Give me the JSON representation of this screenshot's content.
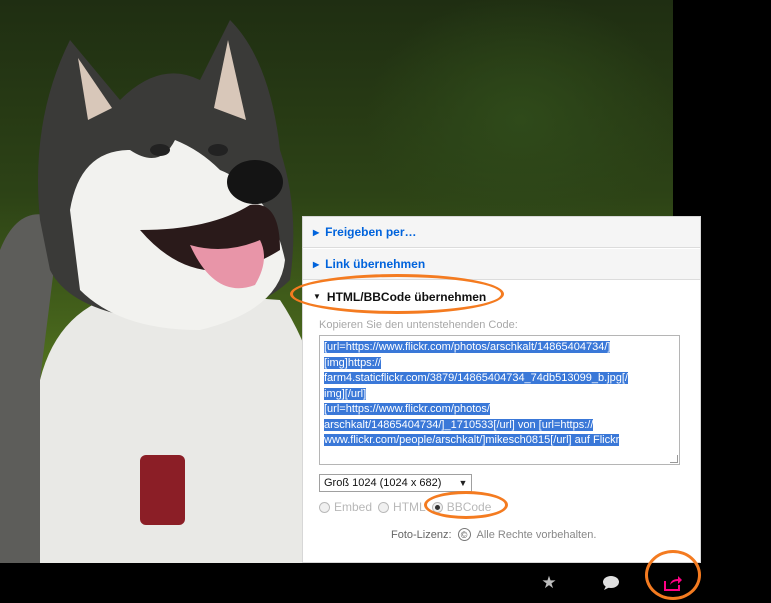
{
  "share_panel": {
    "sections": [
      {
        "label": "Freigeben per…",
        "expanded": false
      },
      {
        "label": "Link übernehmen",
        "expanded": false
      },
      {
        "label": "HTML/BBCode übernehmen",
        "expanded": true
      }
    ],
    "copy_hint": "Kopieren Sie den untenstehenden Code:",
    "code_lines": [
      "[url=https://www.flickr.com/photos/arschkalt/14865404734/]",
      "[img]https://",
      "farm4.staticflickr.com/3879/14865404734_74db513099_b.jpg[/",
      "img][/url]",
      "[url=https://www.flickr.com/photos/",
      "arschkalt/14865404734/]_1710533[/url] von [url=https://",
      "www.flickr.com/people/arschkalt/]mikesch0815[/url] auf Flickr"
    ],
    "size_select": "Groß 1024 (1024 x 682)",
    "format_options": [
      {
        "label": "Embed",
        "selected": false
      },
      {
        "label": "HTML",
        "selected": false
      },
      {
        "label": "BBCode",
        "selected": true
      }
    ],
    "license_label": "Foto-Lizenz:",
    "license_icon": "©",
    "license_text": "Alle Rechte vorbehalten."
  },
  "bottom_bar": {
    "favorite_icon": "star-icon",
    "comment_icon": "comment-icon",
    "share_icon": "share-icon",
    "share_color": "#ff0084"
  },
  "annotation_color": "#f47b20"
}
